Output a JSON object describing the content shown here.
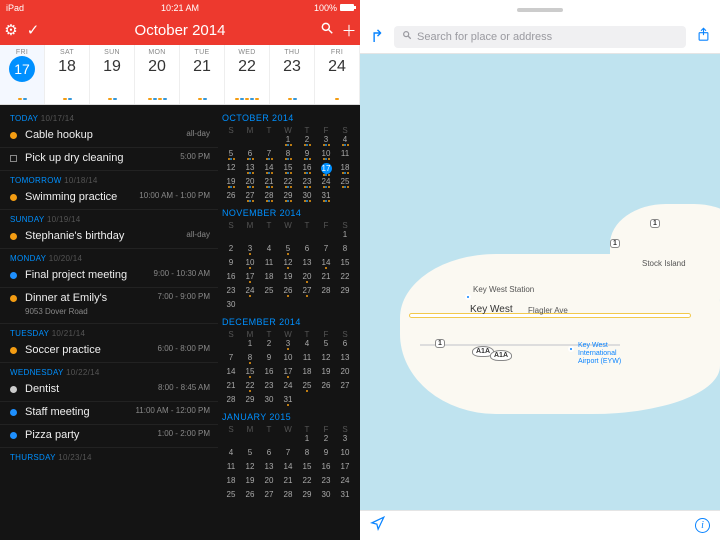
{
  "statusbar": {
    "device": "iPad",
    "time": "10:21 AM",
    "battery": "100%"
  },
  "header": {
    "title": "October 2014"
  },
  "weekstrip": [
    {
      "dow": "FRI",
      "day": "17",
      "today": true
    },
    {
      "dow": "SAT",
      "day": "18"
    },
    {
      "dow": "SUN",
      "day": "19"
    },
    {
      "dow": "MON",
      "day": "20"
    },
    {
      "dow": "TUE",
      "day": "21"
    },
    {
      "dow": "WED",
      "day": "22"
    },
    {
      "dow": "THU",
      "day": "23"
    },
    {
      "dow": "FRI",
      "day": "24"
    }
  ],
  "sections": [
    {
      "label": "TODAY",
      "date": "10/17/14",
      "events": [
        {
          "color": "co",
          "title": "Cable hookup",
          "time": "all-day",
          "shape": "dot"
        },
        {
          "color": "",
          "title": "Pick up dry cleaning",
          "time": "5:00 PM",
          "shape": "box"
        }
      ]
    },
    {
      "label": "TOMORROW",
      "date": "10/18/14",
      "events": [
        {
          "color": "co",
          "title": "Swimming practice",
          "time": "10:00 AM - 1:00 PM",
          "shape": "dot"
        }
      ]
    },
    {
      "label": "SUNDAY",
      "date": "10/19/14",
      "events": [
        {
          "color": "co",
          "title": "Stephanie's birthday",
          "time": "all-day",
          "shape": "dot"
        }
      ]
    },
    {
      "label": "MONDAY",
      "date": "10/20/14",
      "events": [
        {
          "color": "cb",
          "title": "Final project meeting",
          "time": "9:00 - 10:30 AM",
          "shape": "dot"
        },
        {
          "color": "co",
          "title": "Dinner at Emily's",
          "sub": "9053 Dover Road",
          "time": "7:00 - 9:00 PM",
          "shape": "dot"
        }
      ]
    },
    {
      "label": "TUESDAY",
      "date": "10/21/14",
      "events": [
        {
          "color": "co",
          "title": "Soccer practice",
          "time": "6:00 - 8:00 PM",
          "shape": "dot"
        }
      ]
    },
    {
      "label": "WEDNESDAY",
      "date": "10/22/14",
      "events": [
        {
          "color": "cg",
          "title": "Dentist",
          "time": "8:00 - 8:45 AM",
          "shape": "dot"
        },
        {
          "color": "cb",
          "title": "Staff meeting",
          "time": "11:00 AM - 12:00 PM",
          "shape": "dot"
        },
        {
          "color": "cb",
          "title": "Pizza party",
          "time": "1:00 - 2:00 PM",
          "shape": "dot"
        }
      ]
    },
    {
      "label": "THURSDAY",
      "date": "10/23/14",
      "events": []
    }
  ],
  "minicals": {
    "dow": [
      "S",
      "M",
      "T",
      "W",
      "T",
      "F",
      "S"
    ],
    "months": [
      {
        "title": "OCTOBER 2014",
        "startDow": 3,
        "days": 31,
        "today": 17,
        "dotted": [
          1,
          2,
          3,
          4,
          5,
          6,
          7,
          8,
          9,
          10,
          13,
          14,
          15,
          16,
          17,
          18,
          19,
          20,
          21,
          22,
          23,
          24,
          25,
          27,
          28,
          29,
          30,
          31
        ]
      },
      {
        "title": "NOVEMBER 2014",
        "startDow": 6,
        "days": 30,
        "dotted": [
          3,
          5,
          10,
          12,
          14,
          17,
          20,
          24,
          26,
          27
        ]
      },
      {
        "title": "DECEMBER 2014",
        "startDow": 1,
        "days": 31,
        "dotted": [
          3,
          8,
          15,
          17,
          22,
          25,
          31
        ]
      },
      {
        "title": "JANUARY 2015",
        "startDow": 4,
        "days": 31,
        "dotted": []
      }
    ]
  },
  "maps": {
    "search_placeholder": "Search for place or address",
    "labels": {
      "city": "Key West",
      "station": "Key West Station",
      "flagler": "Flagler Ave",
      "airport1": "Key West",
      "airport2": "International",
      "airport3": "Airport (EYW)",
      "stock": "Stock Island"
    },
    "shields": {
      "us1": "1",
      "a1a": "A1A"
    }
  }
}
